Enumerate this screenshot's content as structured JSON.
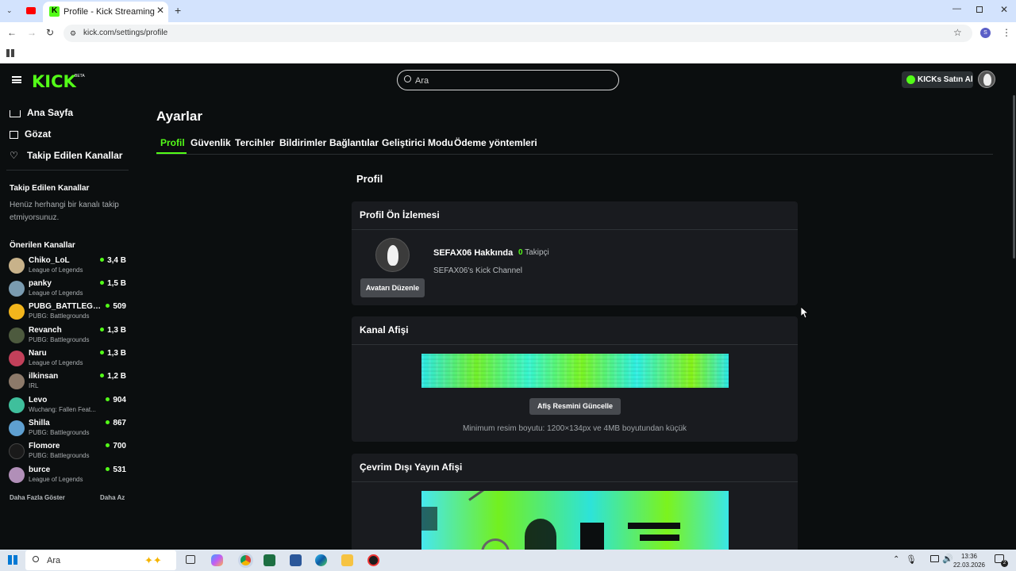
{
  "browser": {
    "tab_title": "Profile - Kick Streaming",
    "url": "kick.com/settings/profile",
    "profile_initial": "S"
  },
  "header": {
    "logo": "KICK",
    "logo_badge": "BETA",
    "search_placeholder": "Ara",
    "kicks_button": "KICKs Satın Al"
  },
  "sidebar": {
    "nav": [
      {
        "label": "Ana Sayfa",
        "icon": "home-icon"
      },
      {
        "label": "Gözat",
        "icon": "browse-icon"
      },
      {
        "label": "Takip Edilen Kanallar",
        "icon": "heart-icon"
      }
    ],
    "followed_title": "Takip Edilen Kanallar",
    "followed_empty": "Henüz herhangi bir kanalı takip etmiyorsunuz.",
    "recommended_title": "Önerilen Kanallar",
    "channels": [
      {
        "name": "Chiko_LoL",
        "game": "League of Legends",
        "viewers": "3,4 B"
      },
      {
        "name": "panky",
        "game": "League of Legends",
        "viewers": "1,5 B"
      },
      {
        "name": "PUBG_BATTLEGR...",
        "game": "PUBG: Battlegrounds",
        "viewers": "509"
      },
      {
        "name": "Revanch",
        "game": "PUBG: Battlegrounds",
        "viewers": "1,3 B"
      },
      {
        "name": "Naru",
        "game": "League of Legends",
        "viewers": "1,3 B"
      },
      {
        "name": "ilkinsan",
        "game": "IRL",
        "viewers": "1,2 B"
      },
      {
        "name": "Levo",
        "game": "Wuchang: Fallen Feat...",
        "viewers": "904"
      },
      {
        "name": "Shilla",
        "game": "PUBG: Battlegrounds",
        "viewers": "867"
      },
      {
        "name": "Flomore",
        "game": "PUBG: Battlegrounds",
        "viewers": "700"
      },
      {
        "name": "burce",
        "game": "League of Legends",
        "viewers": "531"
      }
    ],
    "show_more": "Daha Fazla Göster",
    "show_less": "Daha Az"
  },
  "main": {
    "page_title": "Ayarlar",
    "tabs": [
      "Profil",
      "Güvenlik",
      "Tercihler",
      "Bildirimler",
      "Bağlantılar",
      "Geliştirici Modu",
      "Ödeme yöntemleri"
    ],
    "section_title": "Profil",
    "preview": {
      "title": "Profil Ön İzlemesi",
      "edit_avatar": "Avatarı Düzenle",
      "about": "SEFAX06 Hakkında",
      "followers_count": "0",
      "followers_label": "Takipçi",
      "bio": "SEFAX06's Kick Channel"
    },
    "banner": {
      "title": "Kanal Afişi",
      "update_button": "Afiş Resmini Güncelle",
      "hint": "Minimum resim boyutu: 1200×134px ve 4MB boyutundan küçük"
    },
    "offline": {
      "title": "Çevrim Dışı Yayın Afişi"
    }
  },
  "taskbar": {
    "search_placeholder": "Ara",
    "time": "13:36",
    "date": "22.03.2026",
    "notifications": "2"
  },
  "colors": {
    "accent": "#53fc18",
    "background": "#0b0e0f",
    "card": "#191b1f"
  }
}
